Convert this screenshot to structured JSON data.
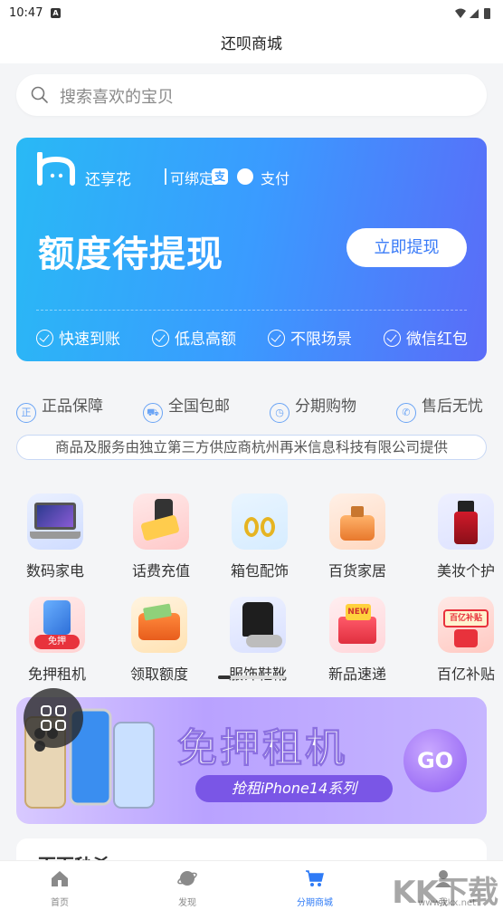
{
  "status": {
    "time": "10:47",
    "a_badge": "A"
  },
  "title": "还呗商城",
  "search": {
    "placeholder": "搜索喜欢的宝贝",
    "icon": "search-icon"
  },
  "hero": {
    "brand": "还享花",
    "bind": "可绑定",
    "alipay_glyph": "支",
    "pay": "支付",
    "headline": "额度待提现",
    "cta": "立即提现",
    "features": [
      "快速到账",
      "低息高额",
      "不限场景",
      "微信红包"
    ],
    "colors": {
      "start": "#29b9f5",
      "end": "#5a6cf8"
    }
  },
  "guarantees": [
    {
      "label": "正品保障",
      "icon": "genuine-icon",
      "glyph": "正"
    },
    {
      "label": "全国包邮",
      "icon": "truck-icon",
      "glyph": "⛟"
    },
    {
      "label": "分期购物",
      "icon": "clock-icon",
      "glyph": "◷"
    },
    {
      "label": "售后无忧",
      "icon": "phone-icon",
      "glyph": "✆"
    }
  ],
  "notice": "商品及服务由独立第三方供应商杭州再米信息科技有限公司提供",
  "categories_row1": [
    {
      "label": "数码家电",
      "icon": "laptop-icon"
    },
    {
      "label": "话费充值",
      "icon": "phone-recharge-icon"
    },
    {
      "label": "箱包配饰",
      "icon": "necklace-icon"
    },
    {
      "label": "百货家居",
      "icon": "perfume-icon"
    },
    {
      "label": "美妆个护",
      "icon": "skincare-icon"
    }
  ],
  "categories_row2": [
    {
      "label": "免押租机",
      "icon": "iphone-icon",
      "tag": "免押"
    },
    {
      "label": "领取额度",
      "icon": "wallet-icon"
    },
    {
      "label": "服饰鞋靴",
      "icon": "jacket-icon"
    },
    {
      "label": "新品速递",
      "icon": "new-box-icon",
      "tag": "NEW"
    },
    {
      "label": "百亿补贴",
      "icon": "subsidy-icon",
      "tag": "百亿补贴"
    }
  ],
  "banner": {
    "title": "免押租机",
    "subtitle": "抢租iPhone14系列",
    "go": "GO"
  },
  "section_peek": "百百秒杀",
  "tabs": [
    {
      "label": "首页",
      "icon": "home-icon"
    },
    {
      "label": "发现",
      "icon": "planet-icon"
    },
    {
      "label": "分期商城",
      "icon": "cart-icon",
      "active": true
    },
    {
      "label": "我",
      "icon": "user-icon"
    }
  ],
  "watermark": {
    "main": "KK下载",
    "url": "www.kkx.net"
  }
}
